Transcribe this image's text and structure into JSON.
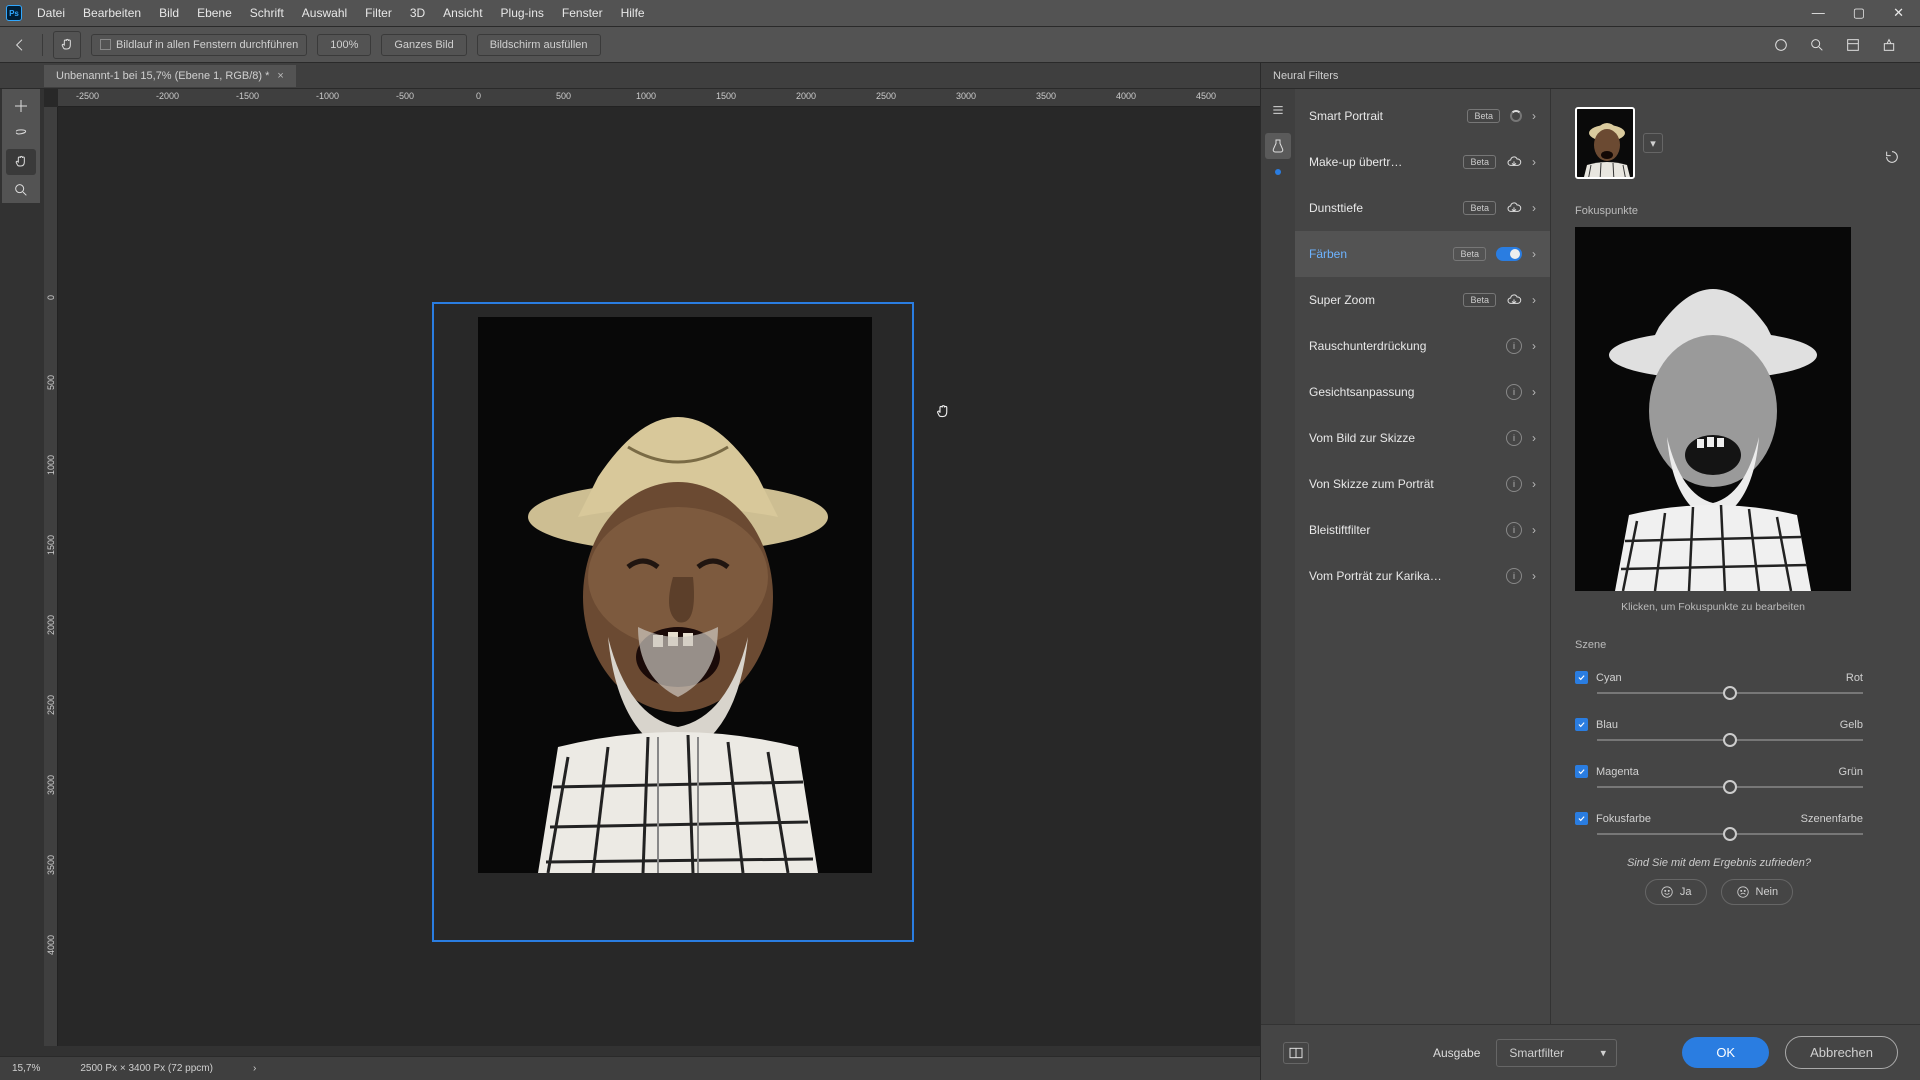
{
  "app": {
    "ps_label": "Ps"
  },
  "menu": [
    "Datei",
    "Bearbeiten",
    "Bild",
    "Ebene",
    "Schrift",
    "Auswahl",
    "Filter",
    "3D",
    "Ansicht",
    "Plug-ins",
    "Fenster",
    "Hilfe"
  ],
  "options": {
    "scroll_all": "Bildlauf in allen Fenstern durchführen",
    "zoom_100": "100%",
    "fit_screen": "Ganzes Bild",
    "fill_screen": "Bildschirm ausfüllen"
  },
  "document": {
    "tab_title": "Unbenannt-1 bei 15,7% (Ebene 1, RGB/8) *"
  },
  "ruler_h": [
    "-2500",
    "-2000",
    "-1500",
    "-1000",
    "-500",
    "0",
    "500",
    "1000",
    "1500",
    "2000",
    "2500",
    "3000",
    "3500",
    "4000",
    "4500"
  ],
  "ruler_v": [
    "0",
    "500",
    "1000",
    "1500",
    "2000",
    "2500",
    "3000",
    "3500",
    "4000"
  ],
  "status": {
    "zoom": "15,7%",
    "dims": "2500 Px × 3400 Px (72 ppcm)",
    "arrow": "›"
  },
  "panel": {
    "title": "Neural Filters",
    "filters": [
      {
        "name": "Smart Portrait",
        "beta": true,
        "ctrl": "spinner"
      },
      {
        "name": "Make-up übertr…",
        "beta": true,
        "ctrl": "cloud"
      },
      {
        "name": "Dunsttiefe",
        "beta": true,
        "ctrl": "cloud"
      },
      {
        "name": "Färben",
        "beta": true,
        "ctrl": "toggle-on",
        "selected": true
      },
      {
        "name": "Super Zoom",
        "beta": true,
        "ctrl": "cloud"
      },
      {
        "name": "Rauschunterdrückung",
        "beta": false,
        "ctrl": "info"
      },
      {
        "name": "Gesichtsanpassung",
        "beta": false,
        "ctrl": "info"
      },
      {
        "name": "Vom Bild zur Skizze",
        "beta": false,
        "ctrl": "info"
      },
      {
        "name": "Von Skizze zum Porträt",
        "beta": false,
        "ctrl": "info"
      },
      {
        "name": "Bleistiftfilter",
        "beta": false,
        "ctrl": "info"
      },
      {
        "name": "Vom Porträt zur Karika…",
        "beta": false,
        "ctrl": "info"
      }
    ],
    "beta_label": "Beta",
    "fokus_label": "Fokuspunkte",
    "fokus_caption": "Klicken, um Fokuspunkte zu bearbeiten",
    "szene_label": "Szene",
    "sliders": [
      {
        "left": "Cyan",
        "right": "Rot",
        "checked": true,
        "pos": 50
      },
      {
        "left": "Blau",
        "right": "Gelb",
        "checked": true,
        "pos": 50
      },
      {
        "left": "Magenta",
        "right": "Grün",
        "checked": true,
        "pos": 50
      },
      {
        "left": "Fokusfarbe",
        "right": "Szenenfarbe",
        "checked": true,
        "pos": 50
      }
    ],
    "feedback_q": "Sind Sie mit dem Ergebnis zufrieden?",
    "feedback_yes": "Ja",
    "feedback_no": "Nein",
    "ausgabe_label": "Ausgabe",
    "ausgabe_value": "Smartfilter",
    "ok": "OK",
    "cancel": "Abbrechen"
  }
}
